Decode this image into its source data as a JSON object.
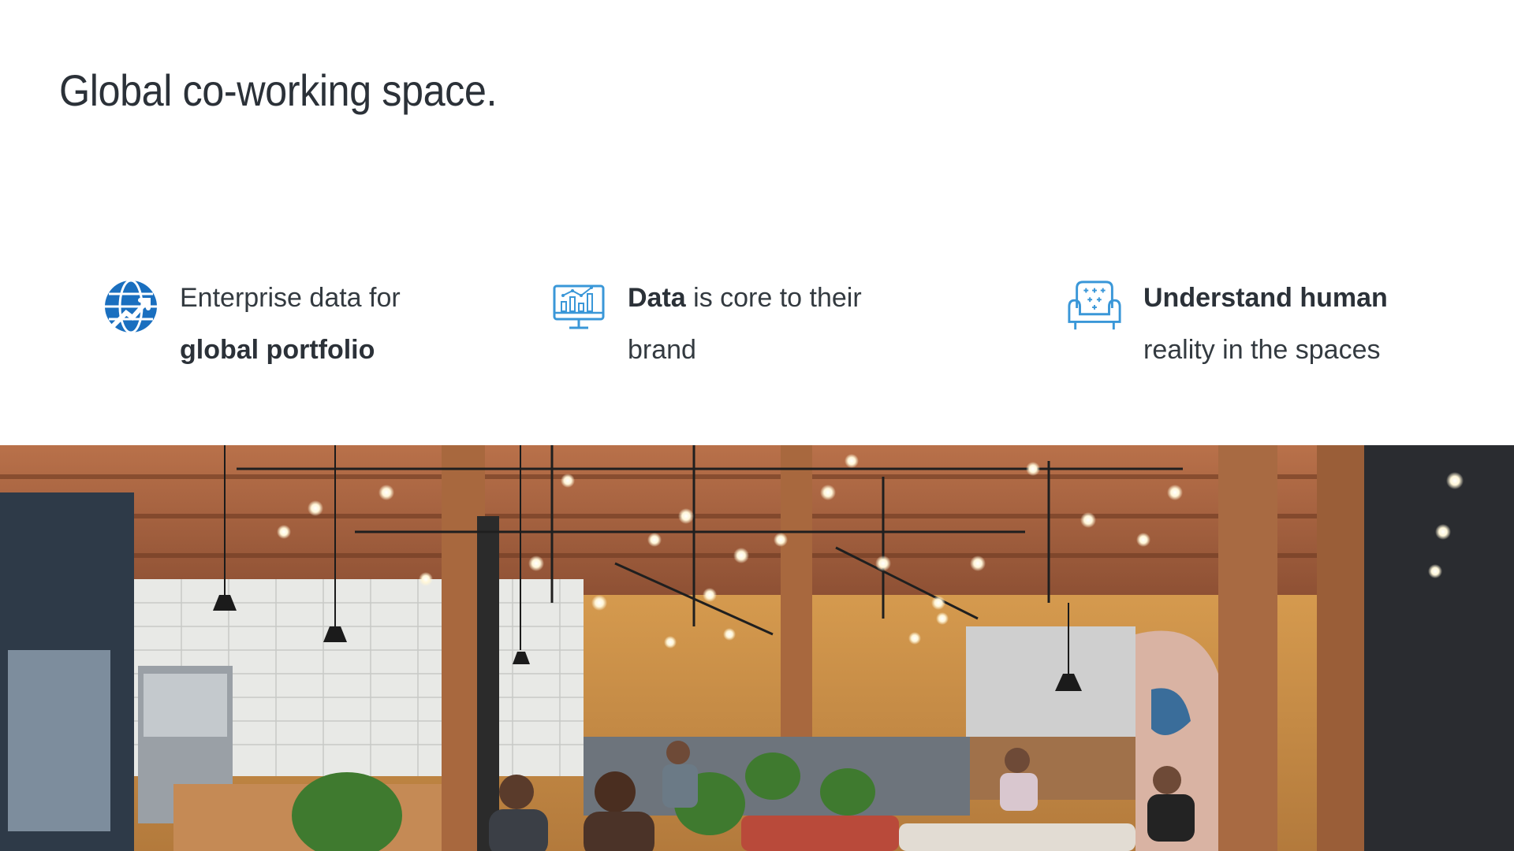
{
  "hero": {
    "title": "Global co-working space."
  },
  "features": [
    {
      "icon": "globe-chart-icon",
      "line1_plain": "Enterprise data for",
      "line2_bold": "global portfolio"
    },
    {
      "icon": "monitor-chart-icon",
      "line1_bold": "Data",
      "line1_plain": " is core to their",
      "line2_plain": "brand"
    },
    {
      "icon": "armchair-icon",
      "line1_bold": "Understand human",
      "line2_plain": "reality in the spaces"
    }
  ],
  "colors": {
    "icon_blue": "#1a73c4",
    "icon_light_blue": "#3a97d8",
    "text": "#333a40"
  },
  "photo": {
    "subject": "co-working-space-photo"
  }
}
